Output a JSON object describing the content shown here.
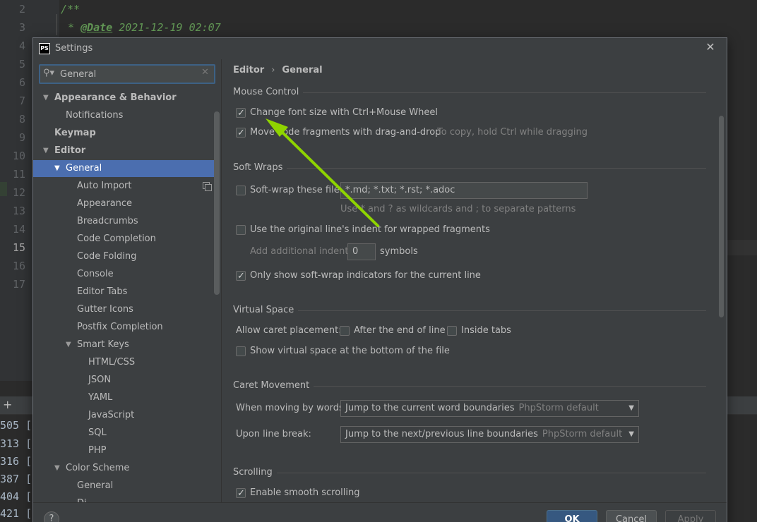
{
  "editor": {
    "line_numbers": [
      "2",
      "3",
      "4",
      "5",
      "6",
      "7",
      "8",
      "9",
      "10",
      "11",
      "12",
      "13",
      "14",
      "15",
      "16",
      "17"
    ],
    "current_line": "15",
    "code_line2": "/**",
    "code_line3_tag": "@Date",
    "code_line3_rest": " 2021-12-19 02:07",
    "terminal_lines": [
      "505 [",
      "313 [",
      "316 [",
      "387 [",
      "404 [",
      "421 ["
    ]
  },
  "dialog": {
    "title": "Settings",
    "app_icon": "PS",
    "close_icon": "close-icon"
  },
  "search": {
    "value": "General",
    "placeholder": ""
  },
  "tree": [
    {
      "label": "Appearance & Behavior",
      "bold": true,
      "arrow": "expanded"
    },
    {
      "label": "Notifications"
    },
    {
      "label": "Keymap",
      "bold": true
    },
    {
      "label": "Editor",
      "bold": true,
      "arrow": "expanded"
    },
    {
      "label": "General",
      "selected": true,
      "arrow": "expanded"
    },
    {
      "label": "Auto Import",
      "copy_icon": true
    },
    {
      "label": "Appearance"
    },
    {
      "label": "Breadcrumbs"
    },
    {
      "label": "Code Completion"
    },
    {
      "label": "Code Folding"
    },
    {
      "label": "Console"
    },
    {
      "label": "Editor Tabs"
    },
    {
      "label": "Gutter Icons"
    },
    {
      "label": "Postfix Completion"
    },
    {
      "label": "Smart Keys",
      "arrow": "expanded"
    },
    {
      "label": "HTML/CSS"
    },
    {
      "label": "JSON"
    },
    {
      "label": "YAML"
    },
    {
      "label": "JavaScript"
    },
    {
      "label": "SQL"
    },
    {
      "label": "PHP"
    },
    {
      "label": "Color Scheme",
      "arrow": "expanded"
    },
    {
      "label": "General"
    },
    {
      "label": "Di..."
    }
  ],
  "breadcrumb": {
    "parent": "Editor",
    "separator": "›",
    "current": "General"
  },
  "mouse_control": {
    "title": "Mouse Control",
    "change_font_size": {
      "label": "Change font size with Ctrl+Mouse Wheel",
      "checked": true
    },
    "move_code": {
      "label": "Move code fragments with drag-and-drop",
      "checked": true,
      "hint": "To copy, hold Ctrl while dragging"
    }
  },
  "soft_wraps": {
    "title": "Soft Wraps",
    "soft_wrap_files": {
      "label": "Soft-wrap these files:",
      "checked": false,
      "value": "*.md; *.txt; *.rst; *.adoc",
      "hint": "Use * and ? as wildcards and ; to separate patterns"
    },
    "original_indent": {
      "label": "Use the original line's indent for wrapped fragments",
      "checked": false
    },
    "additional_indent": {
      "label": "Add additional indent:",
      "value": "0",
      "suffix": "symbols"
    },
    "only_current_line": {
      "label": "Only show soft-wrap indicators for the current line",
      "checked": true
    }
  },
  "virtual_space": {
    "title": "Virtual Space",
    "allow_caret": "Allow caret placement:",
    "after_end": {
      "label": "After the end of line",
      "checked": false
    },
    "inside_tabs": {
      "label": "Inside tabs",
      "checked": false
    },
    "show_virtual": {
      "label": "Show virtual space at the bottom of the file",
      "checked": false
    }
  },
  "caret_movement": {
    "title": "Caret Movement",
    "by_words_label": "When moving by words:",
    "by_words_value": "Jump to the current word boundaries",
    "by_words_note": "PhpStorm default",
    "line_break_label": "Upon line break:",
    "line_break_value": "Jump to the next/previous line boundaries",
    "line_break_note": "PhpStorm default"
  },
  "scrolling": {
    "title": "Scrolling",
    "smooth": {
      "label": "Enable smooth scrolling",
      "checked": true
    }
  },
  "footer": {
    "help": "?",
    "ok": "OK",
    "cancel": "Cancel",
    "apply": "Apply"
  },
  "colors": {
    "accent_selection": "#4b6eaf",
    "ok_button": "#365880",
    "annotation_arrow": "#8fd400"
  }
}
